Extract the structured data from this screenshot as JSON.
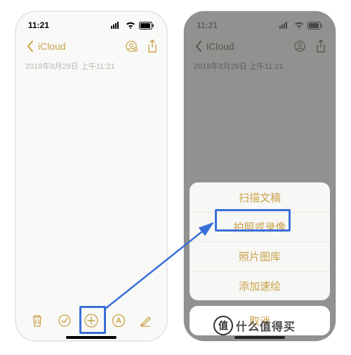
{
  "statusbar": {
    "time": "11:21"
  },
  "navbar": {
    "back_label": "iCloud"
  },
  "note": {
    "datetime": "2018年8月29日 上午11:21"
  },
  "actionsheet": {
    "items": [
      "扫描文稿",
      "拍照或录像",
      "照片图库",
      "添加速绘"
    ],
    "cancel": "取消"
  },
  "watermark": {
    "badge": "值",
    "text": "什么值得买"
  }
}
